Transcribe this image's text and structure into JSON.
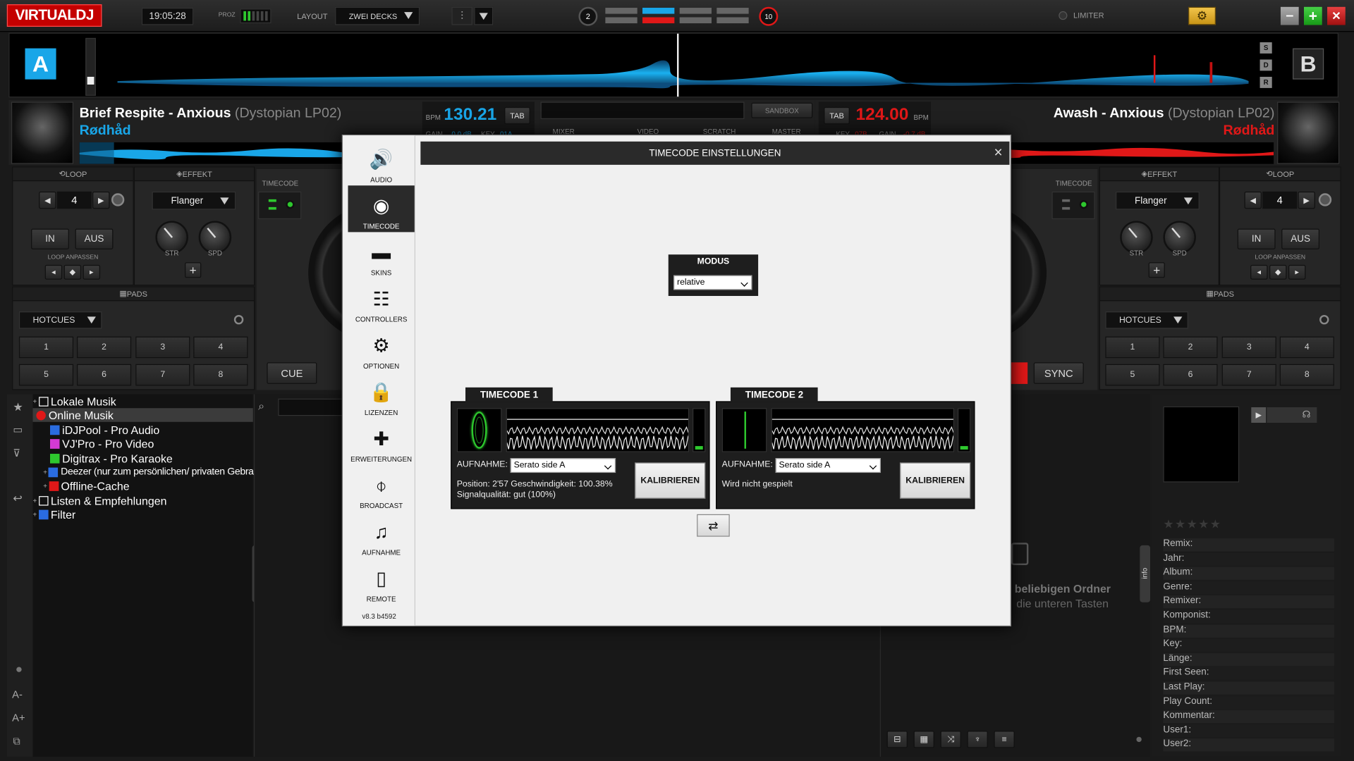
{
  "topbar": {
    "logo": "VIRTUALDJ",
    "clock": "19:05:28",
    "proz_label": "PROZ",
    "layout_label": "LAYOUT",
    "layout_value": "ZWEI DECKS",
    "deck_left_num": "2",
    "deck_right_num": "10",
    "limiter_label": "LIMITER"
  },
  "waveform": {
    "deck_a_badge": "A",
    "deck_b_badge": "B",
    "side_buttons": [
      "S",
      "D",
      "R"
    ]
  },
  "deck_a": {
    "title": "Brief Respite - Anxious",
    "album": "(Dystopian LP02)",
    "artist": "Rødhåd",
    "bpm_label": "BPM",
    "bpm": "130.21",
    "tab": "TAB",
    "gain": "GAIN",
    "gain_value": "0.0 dB",
    "key": "KEY",
    "key_value": "01A",
    "loop_label": "LOOP",
    "loop_value": "4",
    "loop_in": "IN",
    "loop_out": "AUS",
    "loop_adjust": "LOOP ANPASSEN",
    "effect_label": "EFFEKT",
    "effect_value": "Flanger",
    "str": "STR",
    "spd": "SPD",
    "pads_label": "PADS",
    "hotcues": "HOTCUES",
    "pads": [
      "1",
      "2",
      "3",
      "4",
      "5",
      "6",
      "7",
      "8"
    ],
    "timecode_label": "TIMECODE",
    "cue": "CUE",
    "color": "#19a6e8"
  },
  "deck_b": {
    "title": "Awash - Anxious",
    "album": "(Dystopian LP02)",
    "artist": "Rødhåd",
    "bpm_label": "BPM",
    "bpm": "124.00",
    "tab": "TAB",
    "key": "KEY",
    "key_value": "07B",
    "gain": "GAIN",
    "gain_value": "-0.7 dB",
    "loop_label": "LOOP",
    "loop_value": "4",
    "loop_in": "IN",
    "loop_out": "AUS",
    "loop_adjust": "LOOP ANPASSEN",
    "effect_label": "EFFEKT",
    "effect_value": "Flanger",
    "str": "STR",
    "spd": "SPD",
    "pads_label": "PADS",
    "hotcues": "HOTCUES",
    "pads": [
      "1",
      "2",
      "3",
      "4",
      "5",
      "6",
      "7",
      "8"
    ],
    "timecode_label": "TIMECODE",
    "sync": "SYNC",
    "color": "#e01818"
  },
  "center_tabs": {
    "sandbox": "SANDBOX",
    "mixer": "MIXER",
    "video": "VIDEO",
    "scratch": "SCRATCH",
    "master": "MASTER"
  },
  "browser": {
    "tree": [
      {
        "label": "Lokale Musik",
        "color": "#ffffff"
      },
      {
        "label": "Online Musik",
        "color": "#e01818"
      },
      {
        "label": "iDJPool - Pro Audio",
        "color": "#2a6ce0"
      },
      {
        "label": "VJ'Pro - Pro Video",
        "color": "#d43ad4"
      },
      {
        "label": "Digitrax - Pro Karaoke",
        "color": "#2ec82e"
      },
      {
        "label": "Deezer (nur zum persönlichen/ privaten Gebrauch)",
        "color": "#2a6ce0"
      },
      {
        "label": "Offline-Cache",
        "color": "#e01818"
      },
      {
        "label": "Listen & Empfehlungen",
        "color": "#ffffff"
      },
      {
        "label": "Filter",
        "color": "#2a6ce0"
      }
    ],
    "folders_tab": "folders",
    "info_tab": "info",
    "drop_hint_1": "beliebigen Ordner",
    "drop_hint_2": "die unteren Tasten",
    "meta_fields": [
      "Remix:",
      "Jahr:",
      "Album:",
      "Genre:",
      "Remixer:",
      "Komponist:",
      "BPM:",
      "Key:",
      "Länge:",
      "First Seen:",
      "Last Play:",
      "Play Count:",
      "Kommentar:",
      "User1:",
      "User2:"
    ]
  },
  "dialog": {
    "title": "TIMECODE EINSTELLUNGEN",
    "close": "×",
    "sidebar": [
      {
        "label": "AUDIO",
        "icon": "speaker-icon"
      },
      {
        "label": "TIMECODE",
        "icon": "vinyl-icon"
      },
      {
        "label": "SKINS",
        "icon": "monitor-icon"
      },
      {
        "label": "CONTROLLERS",
        "icon": "sliders-icon"
      },
      {
        "label": "OPTIONEN",
        "icon": "gear-icon"
      },
      {
        "label": "LIZENZEN",
        "icon": "lock-icon"
      },
      {
        "label": "ERWEITERUNGEN",
        "icon": "puzzle-icon"
      },
      {
        "label": "BROADCAST",
        "icon": "broadcast-icon"
      },
      {
        "label": "AUFNAHME",
        "icon": "music-folder-icon"
      },
      {
        "label": "REMOTE",
        "icon": "tablet-icon"
      }
    ],
    "version": "v8.3 b4592",
    "modus_label": "MODUS",
    "modus_value": "relative",
    "tc1": {
      "title": "TIMECODE 1",
      "aufnahme_label": "AUFNAHME:",
      "aufnahme_value": "Serato side A",
      "calibrate": "KALIBRIEREN",
      "line1": "Position: 2'57  Geschwindigkeit: 100.38%",
      "line2": "Signalqualität: gut (100%)"
    },
    "tc2": {
      "title": "TIMECODE 2",
      "aufnahme_label": "AUFNAHME:",
      "aufnahme_value": "Serato side A",
      "calibrate": "KALIBRIEREN",
      "line1": "Wird nicht gespielt"
    }
  }
}
